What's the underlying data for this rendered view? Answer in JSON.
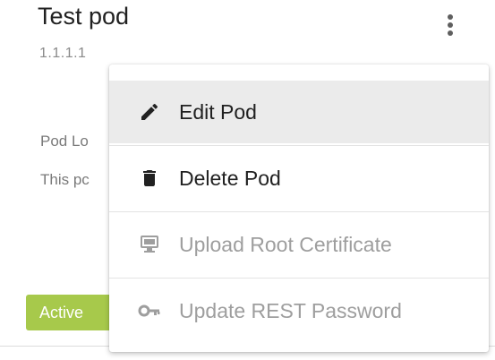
{
  "pod": {
    "title": "Test pod",
    "ip": "1.1.1.1",
    "location_label": "Pod Lo",
    "description": "This pc",
    "status": "Active"
  },
  "menu": {
    "items": [
      {
        "label": "Edit Pod",
        "icon": "pencil-icon",
        "enabled": true,
        "highlighted": true
      },
      {
        "label": "Delete Pod",
        "icon": "trash-icon",
        "enabled": true
      },
      {
        "label": "Upload Root Certificate",
        "icon": "monitor-icon",
        "enabled": false
      },
      {
        "label": "Update REST Password",
        "icon": "key-icon",
        "enabled": false
      }
    ]
  },
  "colors": {
    "status_badge": "#a7c94b",
    "menu_hover": "#ebebeb",
    "disabled_text": "#9e9e9e"
  }
}
